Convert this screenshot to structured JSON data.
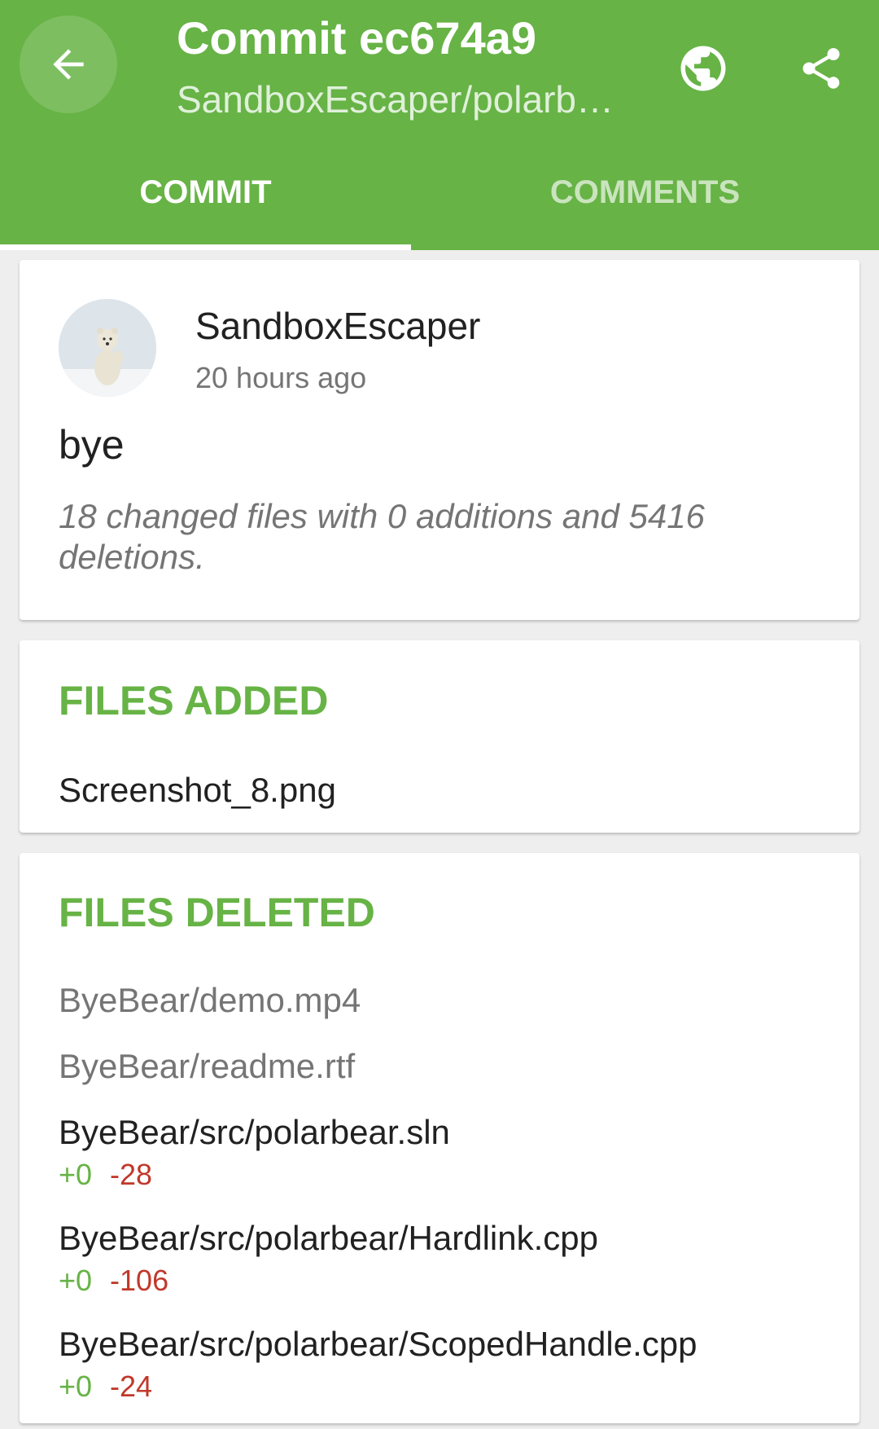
{
  "header": {
    "title": "Commit ec674a9",
    "subtitle": "SandboxEscaper/polarb…",
    "back_icon": "arrow-back-icon",
    "browser_icon": "globe-icon",
    "share_icon": "share-icon",
    "accent_color": "#67b346"
  },
  "tabs": [
    {
      "label": "COMMIT",
      "selected": true
    },
    {
      "label": "COMMENTS",
      "selected": false
    }
  ],
  "commit": {
    "author": "SandboxEscaper",
    "time": "20 hours ago",
    "message": "bye",
    "summary": "18 changed files with 0 additions and 5416 deletions."
  },
  "files_added": {
    "title": "FILES ADDED",
    "files": [
      "Screenshot_8.png"
    ]
  },
  "files_deleted": {
    "title": "FILES DELETED",
    "files": [
      {
        "name": "ByeBear/demo.mp4",
        "additions": "",
        "deletions": ""
      },
      {
        "name": "ByeBear/readme.rtf",
        "additions": "",
        "deletions": ""
      },
      {
        "name": "ByeBear/src/polarbear.sln",
        "additions": "+0",
        "deletions": "-28"
      },
      {
        "name": "ByeBear/src/polarbear/Hardlink.cpp",
        "additions": "+0",
        "deletions": "-106"
      },
      {
        "name": "ByeBear/src/polarbear/ScopedHandle.cpp",
        "additions": "+0",
        "deletions": "-24"
      }
    ]
  }
}
